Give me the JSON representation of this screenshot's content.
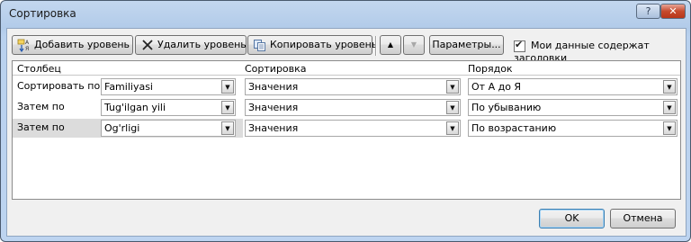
{
  "window": {
    "title": "Сортировка",
    "help_label": "?",
    "close_label": "✕"
  },
  "toolbar": {
    "add_level": "Добавить уровень",
    "delete_level": "Удалить уровень",
    "copy_level": "Копировать уровень",
    "move_up": "▲",
    "move_down": "▼",
    "options": "Параметры...",
    "headers_checkbox_label": "Мои данные содержат заголовки",
    "headers_checkbox_checked": true
  },
  "grid": {
    "columns": [
      "Столбец",
      "Сортировка",
      "Порядок"
    ],
    "rows": [
      {
        "label": "Сортировать по",
        "column": "Familiyasi",
        "sort_on": "Значения",
        "order": "От А до Я"
      },
      {
        "label": "Затем по",
        "column": "Tug'ilgan yili",
        "sort_on": "Значения",
        "order": "По убыванию"
      },
      {
        "label": "Затем по",
        "column": "Og'rligi",
        "sort_on": "Значения",
        "order": "По возрастанию"
      }
    ],
    "selected_row": 2
  },
  "footer": {
    "ok": "OK",
    "cancel": "Отмена"
  }
}
